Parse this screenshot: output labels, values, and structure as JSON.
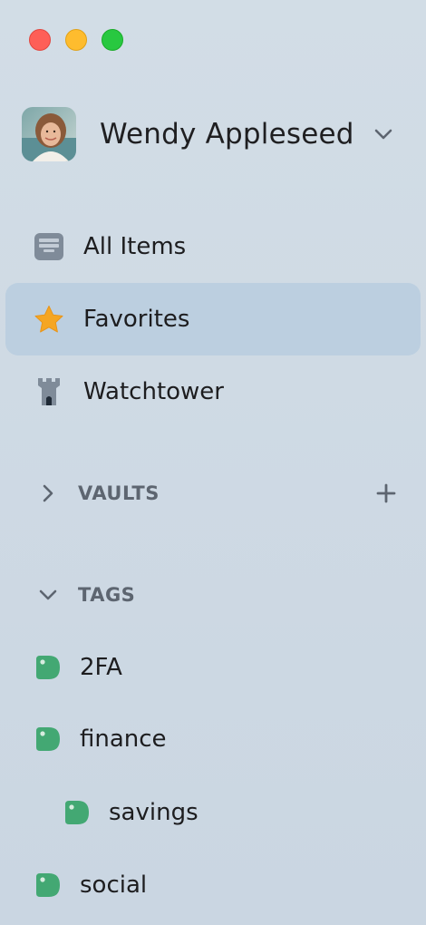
{
  "window": {
    "controls": [
      {
        "name": "close",
        "color": "#fe5f57"
      },
      {
        "name": "minimize",
        "color": "#febc2e"
      },
      {
        "name": "zoom",
        "color": "#28c840"
      }
    ]
  },
  "account": {
    "name": "Wendy Appleseed",
    "avatar_icon": "user-avatar-photo",
    "menu_icon": "chevron-down-icon"
  },
  "nav": {
    "items": [
      {
        "label": "All Items",
        "icon": "all-items-icon",
        "selected": false
      },
      {
        "label": "Favorites",
        "icon": "star-icon",
        "selected": true
      },
      {
        "label": "Watchtower",
        "icon": "tower-icon",
        "selected": false
      }
    ]
  },
  "vaults": {
    "label": "VAULTS",
    "expanded": false,
    "add_icon": "plus-icon"
  },
  "tags": {
    "label": "TAGS",
    "expanded": true,
    "color": "#43a873",
    "items": [
      {
        "label": "2FA",
        "indent": 0
      },
      {
        "label": "finance",
        "indent": 0
      },
      {
        "label": "savings",
        "indent": 1
      },
      {
        "label": "social",
        "indent": 0
      }
    ]
  },
  "colors": {
    "sidebar_bg": "#cfdae4",
    "selection": "#bccfe0",
    "star": "#f5a623",
    "tag": "#43a873",
    "section_text": "#5d6570"
  }
}
